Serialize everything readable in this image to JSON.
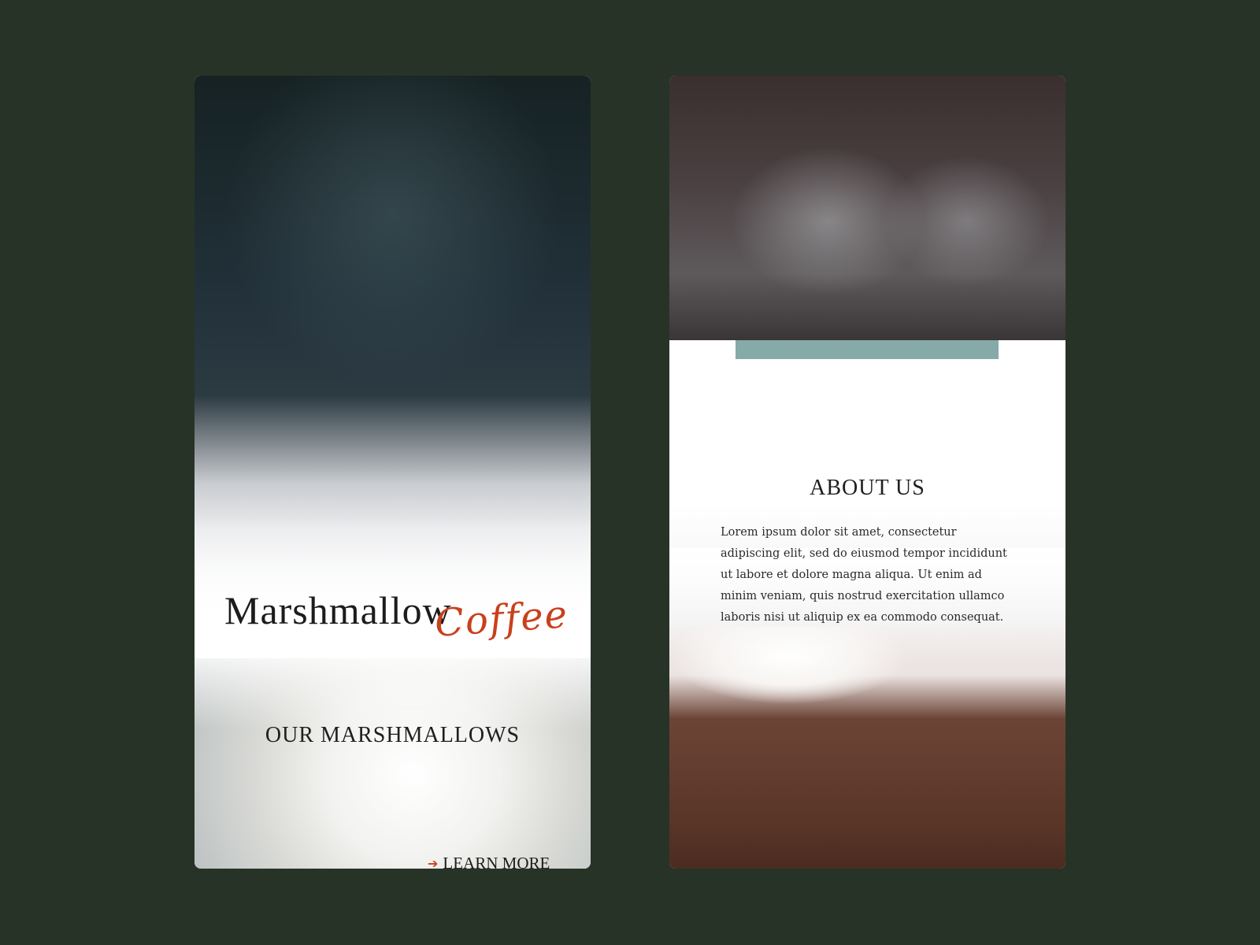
{
  "left_card": {
    "title": "Marshmallow",
    "script_word": "Coffee",
    "section_heading": "OUR MARSHMALLOWS",
    "cta_label": "LEARN MORE",
    "cta_icon": "arrow-right-icon"
  },
  "right_card": {
    "section_heading": "ABOUT US",
    "body_text": "Lorem ipsum dolor sit amet, consectetur adipiscing elit, sed do eiusmod tempor incididunt ut labore et dolore magna aliqua. Ut enim ad minim veniam, quis nostrud exercitation ullamco laboris nisi ut aliquip ex ea commodo consequat."
  },
  "colors": {
    "background": "#283327",
    "accent_orange": "#c9401c",
    "accent_teal": "#86aaa8",
    "text_dark": "#1c1c1c"
  }
}
